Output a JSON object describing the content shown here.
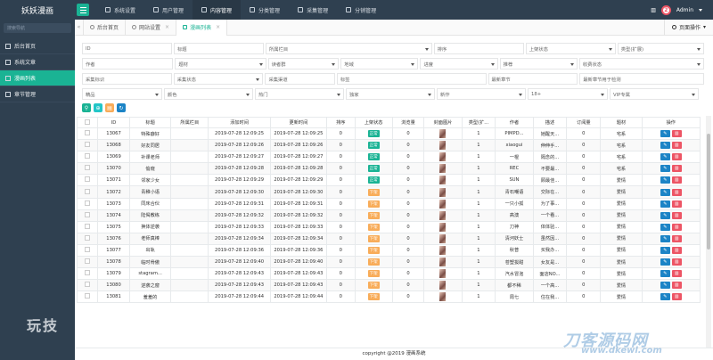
{
  "app": {
    "title": "妖妖漫画"
  },
  "topnav": [
    {
      "label": "系统设置",
      "active": false
    },
    {
      "label": "用户管理",
      "active": false
    },
    {
      "label": "内容管理",
      "active": true
    },
    {
      "label": "分类管理",
      "active": false
    },
    {
      "label": "采集管理",
      "active": false
    },
    {
      "label": "分销管理",
      "active": false
    }
  ],
  "user": {
    "name": "Admin",
    "avatar_char": "2"
  },
  "sidebar": {
    "search_placeholder": "搜索导航",
    "items": [
      {
        "label": "后台首页",
        "active": false
      },
      {
        "label": "系统文章",
        "active": false
      },
      {
        "label": "漫画列表",
        "active": true
      },
      {
        "label": "章节管理",
        "active": false
      }
    ]
  },
  "tabs": [
    {
      "label": "后台首页",
      "active": false,
      "closable": false
    },
    {
      "label": "网站设置",
      "active": false,
      "closable": true
    },
    {
      "label": "漫画列表",
      "active": true,
      "closable": true
    }
  ],
  "page_ops_label": "页面操作",
  "filters": {
    "row1": [
      {
        "text": "ID",
        "w": 0
      },
      {
        "text": "标题"
      },
      {
        "text": "所属栏目",
        "select": true
      },
      {
        "text": "排序"
      },
      {
        "text": "上架状态",
        "select": true
      },
      {
        "text": "类型(扩展)",
        "select": true
      }
    ],
    "row2": [
      {
        "text": "作者"
      },
      {
        "text": "题材",
        "select": true
      },
      {
        "text": "读者群",
        "select": true
      },
      {
        "text": "地域",
        "select": true
      },
      {
        "text": "进度",
        "select": true
      },
      {
        "text": "推荐",
        "select": true
      },
      {
        "text": "收费状态",
        "select": true
      }
    ],
    "row3": [
      {
        "text": "采集标识"
      },
      {
        "text": "采集状态",
        "select": true
      },
      {
        "text": "采集渠道"
      },
      {
        "text": "标签"
      },
      {
        "text": "最新章节"
      },
      {
        "text": "最新章节用于检测"
      }
    ],
    "row4": [
      {
        "text": "精品",
        "select": true
      },
      {
        "text": "颜色",
        "select": true
      },
      {
        "text": "热门",
        "select": true
      },
      {
        "text": "独家",
        "select": true
      },
      {
        "text": "新作",
        "select": true
      },
      {
        "text": "18+",
        "select": true
      },
      {
        "text": "VIP专属",
        "select": true
      }
    ]
  },
  "table": {
    "headers": [
      "",
      "ID",
      "标题",
      "所属栏目",
      "添加时间",
      "更新时间",
      "排序",
      "上架状态",
      "浏览量",
      "封面图片",
      "类型(扩...",
      "作者",
      "描述",
      "订阅量",
      "题材",
      "操作"
    ],
    "rows": [
      {
        "id": "13067",
        "title": "特殊癖好",
        "col": "",
        "add": "2019-07-28 12:09:25",
        "upd": "2019-07-28 12:09:25",
        "sort": "0",
        "status": "正常",
        "views": "0",
        "type": "1",
        "author": "PIMPD...",
        "desc": "她醒天...",
        "subs": "0",
        "genre": "宅系"
      },
      {
        "id": "13068",
        "title": "好友同居",
        "col": "",
        "add": "2019-07-28 12:09:26",
        "upd": "2019-07-28 12:09:26",
        "sort": "0",
        "status": "正常",
        "views": "0",
        "type": "1",
        "author": "xiaogui",
        "desc": "伸伸手...",
        "subs": "0",
        "genre": "宅系"
      },
      {
        "id": "13069",
        "title": "补课老师",
        "col": "",
        "add": "2019-07-28 12:09:27",
        "upd": "2019-07-28 12:09:27",
        "sort": "0",
        "status": "正常",
        "views": "0",
        "type": "1",
        "author": "一棍",
        "desc": "隔念的...",
        "subs": "0",
        "genre": "宅系"
      },
      {
        "id": "13070",
        "title": "偷窥",
        "col": "",
        "add": "2019-07-28 12:09:28",
        "upd": "2019-07-28 12:09:28",
        "sort": "0",
        "status": "正常",
        "views": "0",
        "type": "1",
        "author": "REC",
        "desc": "不要最...",
        "subs": "0",
        "genre": "宅系"
      },
      {
        "id": "13071",
        "title": "邻家少女",
        "col": "",
        "add": "2019-07-28 12:09:29",
        "upd": "2019-07-28 12:09:29",
        "sort": "0",
        "status": "正常",
        "views": "0",
        "type": "1",
        "author": "SUN",
        "desc": "顾最佳...",
        "subs": "0",
        "genre": "爱情"
      },
      {
        "id": "13072",
        "title": "青稚小语",
        "col": "",
        "add": "2019-07-28 12:09:30",
        "upd": "2019-07-28 12:09:30",
        "sort": "0",
        "status": "下架",
        "views": "0",
        "type": "1",
        "author": "青石嘲语",
        "desc": "交际在...",
        "subs": "0",
        "genre": "爱情"
      },
      {
        "id": "13073",
        "title": "同床合伙",
        "col": "",
        "add": "2019-07-28 12:09:31",
        "upd": "2019-07-28 12:09:31",
        "sort": "0",
        "status": "下架",
        "views": "0",
        "type": "1",
        "author": "一只小孤",
        "desc": "为了事...",
        "subs": "0",
        "genre": "爱情"
      },
      {
        "id": "13074",
        "title": "陆偈教练",
        "col": "",
        "add": "2019-07-28 12:09:32",
        "upd": "2019-07-28 12:09:32",
        "sort": "0",
        "status": "下架",
        "views": "0",
        "type": "1",
        "author": "高澳",
        "desc": "一个看...",
        "subs": "0",
        "genre": "爱情"
      },
      {
        "id": "13075",
        "title": "换体逆袭",
        "col": "",
        "add": "2019-07-28 12:09:33",
        "upd": "2019-07-28 12:09:33",
        "sort": "0",
        "status": "下架",
        "views": "0",
        "type": "1",
        "author": "刀神",
        "desc": "体体验...",
        "subs": "0",
        "genre": "爱情"
      },
      {
        "id": "13076",
        "title": "老师真棒",
        "col": "",
        "add": "2019-07-28 12:09:34",
        "upd": "2019-07-28 12:09:34",
        "sort": "0",
        "status": "下架",
        "views": "0",
        "type": "1",
        "author": "清河妖士",
        "desc": "虽然因...",
        "subs": "0",
        "genre": "爱情"
      },
      {
        "id": "13077",
        "title": "出轨",
        "col": "",
        "add": "2019-07-28 12:09:36",
        "upd": "2019-07-28 12:09:36",
        "sort": "0",
        "status": "下架",
        "views": "0",
        "type": "1",
        "author": "秋普",
        "desc": "买我办...",
        "subs": "0",
        "genre": "爱情"
      },
      {
        "id": "13078",
        "title": "临时骨傲",
        "col": "",
        "add": "2019-07-28 12:09:40",
        "upd": "2019-07-28 12:09:40",
        "sort": "0",
        "status": "下架",
        "views": "0",
        "type": "1",
        "author": "苍塑拔甜",
        "desc": "女友是...",
        "subs": "0",
        "genre": "爱情"
      },
      {
        "id": "13079",
        "title": "stagram...",
        "col": "",
        "add": "2019-07-28 12:09:43",
        "upd": "2019-07-28 12:09:43",
        "sort": "0",
        "status": "下架",
        "views": "0",
        "type": "1",
        "author": "汽水冒泡",
        "desc": "面店NO...",
        "subs": "0",
        "genre": "爱情"
      },
      {
        "id": "13080",
        "title": "逆袭之窗",
        "col": "",
        "add": "2019-07-28 12:09:43",
        "upd": "2019-07-28 12:09:43",
        "sort": "0",
        "status": "下架",
        "views": "0",
        "type": "1",
        "author": "都不稀",
        "desc": "一个高...",
        "subs": "0",
        "genre": "爱情"
      },
      {
        "id": "13081",
        "title": "羞羞的",
        "col": "",
        "add": "2019-07-28 12:09:44",
        "upd": "2019-07-28 12:09:44",
        "sort": "0",
        "status": "下架",
        "views": "0",
        "type": "1",
        "author": "周七",
        "desc": "住在我...",
        "subs": "0",
        "genre": "爱情"
      }
    ]
  },
  "footer": "copyright @2019 漫画系统",
  "watermarks": {
    "left": "玩技",
    "right": "刀客源码网",
    "right2": "www.dkewl.com"
  },
  "colors": {
    "sidebar": "#2f4050",
    "accent": "#1ab394",
    "status_on": "#1ab394",
    "status_off": "#f8ac59",
    "edit": "#1c84c6",
    "delete": "#ed5565"
  }
}
